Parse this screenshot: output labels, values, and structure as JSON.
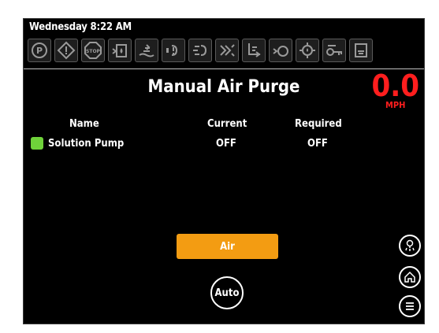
{
  "header": {
    "datetime": "Wednesday 8:22 AM",
    "indicators": [
      "parking-brake-icon",
      "warning-icon",
      "stop-icon",
      "solution-tank-icon",
      "solution-flow-icon",
      "pump-icon",
      "brush-icon",
      "spray-icon",
      "vacuum-icon",
      "filter-icon",
      "hydraulic-icon",
      "key-icon",
      "recovery-tank-icon"
    ]
  },
  "main": {
    "title": "Manual Air Purge",
    "speed_value": "0.0",
    "speed_unit": "MPH",
    "columns": {
      "name": "Name",
      "current": "Current",
      "required": "Required"
    },
    "rows": [
      {
        "name": "Solution Pump",
        "current": "OFF",
        "required": "OFF",
        "status_color": "#6fd23a"
      }
    ],
    "air_button": "Air",
    "auto_button": "Auto"
  },
  "side_buttons": [
    "spray-mode-icon",
    "home-icon",
    "menu-icon"
  ],
  "colors": {
    "accent": "#f39c12",
    "speed": "#ff1e1e",
    "status": "#6fd23a"
  }
}
